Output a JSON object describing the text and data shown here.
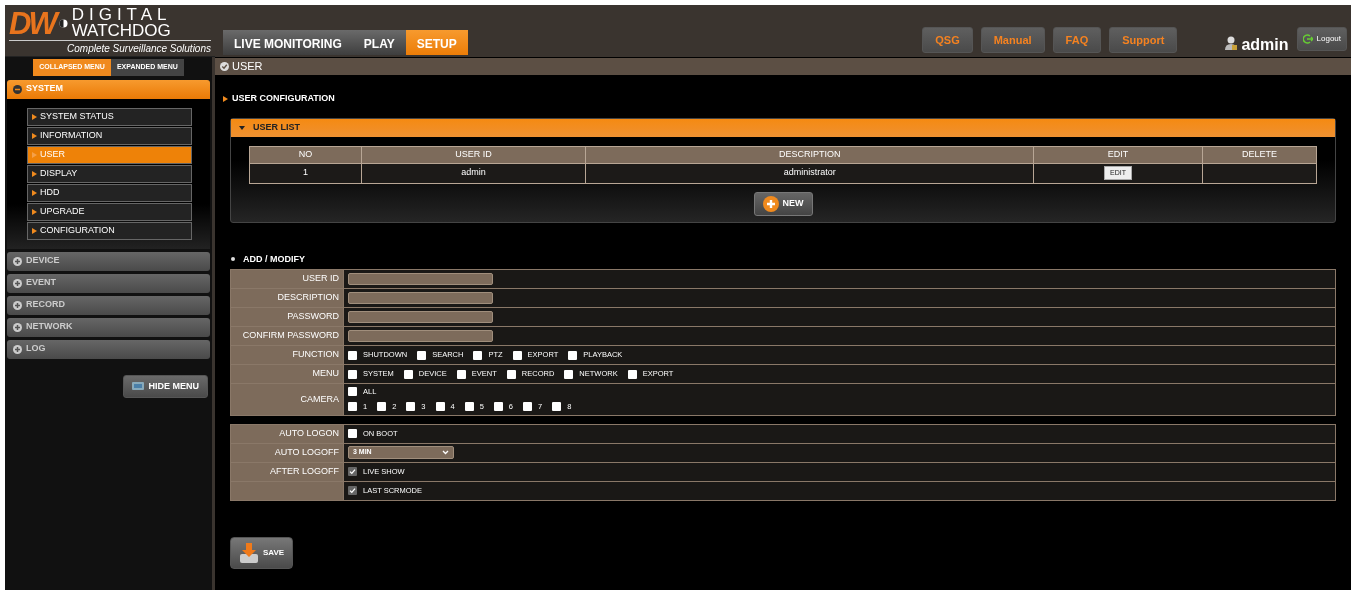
{
  "logo": {
    "mark": "DW",
    "name_top": "DIGITAL",
    "name_bottom": "WATCHDOG",
    "tagline": "Complete Surveillance Solutions"
  },
  "top_tabs": [
    {
      "label": "LIVE MONITORING",
      "selected": false
    },
    {
      "label": "PLAY",
      "selected": false
    },
    {
      "label": "SETUP",
      "selected": true
    }
  ],
  "help_buttons": [
    "QSG",
    "Manual",
    "FAQ",
    "Support"
  ],
  "user": "admin",
  "logout": "Logout",
  "menu_modes": [
    {
      "label": "COLLAPSED MENU",
      "selected": true
    },
    {
      "label": "EXPANDED MENU",
      "selected": false
    }
  ],
  "sidebar": [
    {
      "label": "SYSTEM",
      "expanded": true,
      "children": [
        {
          "label": "SYSTEM STATUS",
          "selected": false
        },
        {
          "label": "INFORMATION",
          "selected": false
        },
        {
          "label": "USER",
          "selected": true
        },
        {
          "label": "DISPLAY",
          "selected": false
        },
        {
          "label": "HDD",
          "selected": false
        },
        {
          "label": "UPGRADE",
          "selected": false
        },
        {
          "label": "CONFIGURATION",
          "selected": false
        }
      ]
    },
    {
      "label": "DEVICE",
      "expanded": false
    },
    {
      "label": "EVENT",
      "expanded": false
    },
    {
      "label": "RECORD",
      "expanded": false
    },
    {
      "label": "NETWORK",
      "expanded": false
    },
    {
      "label": "LOG",
      "expanded": false
    }
  ],
  "hide_menu": "HIDE MENU",
  "page_title": "USER",
  "section_title": "USER CONFIGURATION",
  "user_list": {
    "title": "USER LIST",
    "columns": [
      "NO",
      "USER ID",
      "DESCRIPTION",
      "EDIT",
      "DELETE"
    ],
    "rows": [
      {
        "no": "1",
        "user_id": "admin",
        "description": "administrator",
        "edit": "EDIT"
      }
    ],
    "new_button": "NEW"
  },
  "add_modify": {
    "title": "ADD / MODIFY",
    "groups": [
      [
        {
          "label": "USER ID",
          "kind": "text"
        },
        {
          "label": "DESCRIPTION",
          "kind": "text"
        },
        {
          "label": "PASSWORD",
          "kind": "text"
        },
        {
          "label": "CONFIRM PASSWORD",
          "kind": "text"
        },
        {
          "label": "FUNCTION",
          "kind": "checks",
          "lines": [
            [
              {
                "label": "SHUTDOWN",
                "checked": false
              },
              {
                "label": "SEARCH",
                "checked": false
              },
              {
                "label": "PTZ",
                "checked": false
              },
              {
                "label": "EXPORT",
                "checked": false
              },
              {
                "label": "PLAYBACK",
                "checked": false
              }
            ]
          ]
        },
        {
          "label": "MENU",
          "kind": "checks",
          "lines": [
            [
              {
                "label": "SYSTEM",
                "checked": false
              },
              {
                "label": "DEVICE",
                "checked": false
              },
              {
                "label": "EVENT",
                "checked": false
              },
              {
                "label": "RECORD",
                "checked": false
              },
              {
                "label": "NETWORK",
                "checked": false
              },
              {
                "label": "EXPORT",
                "checked": false
              }
            ]
          ]
        },
        {
          "label": "CAMERA",
          "kind": "checks",
          "lines": [
            [
              {
                "label": "ALL",
                "checked": false
              }
            ],
            [
              {
                "label": "1",
                "checked": false
              },
              {
                "label": "2",
                "checked": false
              },
              {
                "label": "3",
                "checked": false
              },
              {
                "label": "4",
                "checked": false
              },
              {
                "label": "5",
                "checked": false
              },
              {
                "label": "6",
                "checked": false
              },
              {
                "label": "7",
                "checked": false
              },
              {
                "label": "8",
                "checked": false
              }
            ]
          ]
        }
      ],
      [
        {
          "label": "AUTO LOGON",
          "kind": "checks",
          "lines": [
            [
              {
                "label": "ON BOOT",
                "checked": false
              }
            ]
          ]
        },
        {
          "label": "AUTO LOGOFF",
          "kind": "select",
          "value": "3 MIN"
        },
        {
          "label": "AFTER LOGOFF",
          "kind": "checks",
          "lines": [
            [
              {
                "label": "LIVE SHOW",
                "checked": true
              }
            ]
          ]
        },
        {
          "kind": "checks",
          "lines": [
            [
              {
                "label": "LAST SCRMODE",
                "checked": true
              }
            ]
          ]
        }
      ]
    ]
  },
  "save_button": "SAVE"
}
